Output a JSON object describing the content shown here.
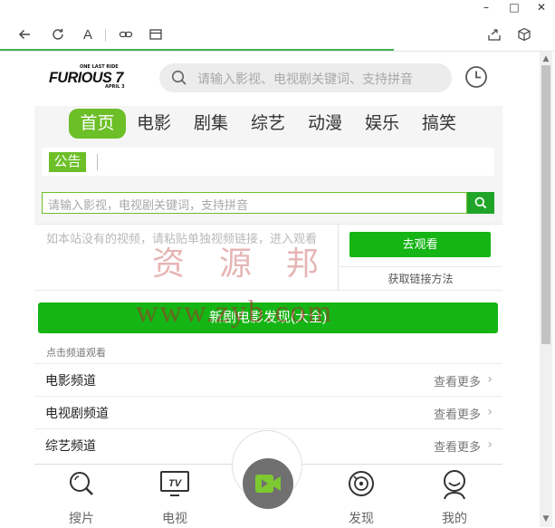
{
  "window": {
    "minimize": "–",
    "maximize": "□",
    "close": "✕"
  },
  "toolbar": {
    "font_label": "A"
  },
  "header": {
    "logo_tagline": "ONE LAST RIDE",
    "logo_title": "FURIOUS 7",
    "logo_date": "APRIL 3",
    "search_placeholder": "请输入影视、电视剧关键词、支持拼音"
  },
  "nav": {
    "items": [
      {
        "label": "首页",
        "active": true
      },
      {
        "label": "电影"
      },
      {
        "label": "剧集"
      },
      {
        "label": "综艺"
      },
      {
        "label": "动漫"
      },
      {
        "label": "娱乐"
      },
      {
        "label": "搞笑"
      }
    ]
  },
  "notice": {
    "tag": "公告"
  },
  "search2": {
    "placeholder": "请输入影视，电视剧关键词，支持拼音"
  },
  "link_box": {
    "hint": "如本站没有的视频，请粘贴单独视频链接，进入观看",
    "go_button": "去观看",
    "get_link": "获取链接方法"
  },
  "watermark": {
    "line1": "资源邦",
    "line2": "www.zyb.com"
  },
  "discover_button": "新剧电影发现(大全)",
  "section_label": "点击频道观看",
  "channels": [
    {
      "title": "电影频道",
      "more": "查看更多"
    },
    {
      "title": "电视剧频道",
      "more": "查看更多"
    },
    {
      "title": "综艺频道",
      "more": "查看更多"
    }
  ],
  "tabbar": {
    "tabs": [
      {
        "label": "搜片",
        "icon": "search-icon"
      },
      {
        "label": "电视",
        "icon": "tv-icon"
      },
      {
        "label": "发现",
        "icon": "discover-icon"
      },
      {
        "label": "我的",
        "icon": "user-icon"
      }
    ],
    "center_icon": "video-camera-icon"
  },
  "colors": {
    "accent_green": "#6cbf27",
    "button_green": "#14b514",
    "progress_green": "#3fb34f"
  },
  "page_load_progress": 0.71
}
